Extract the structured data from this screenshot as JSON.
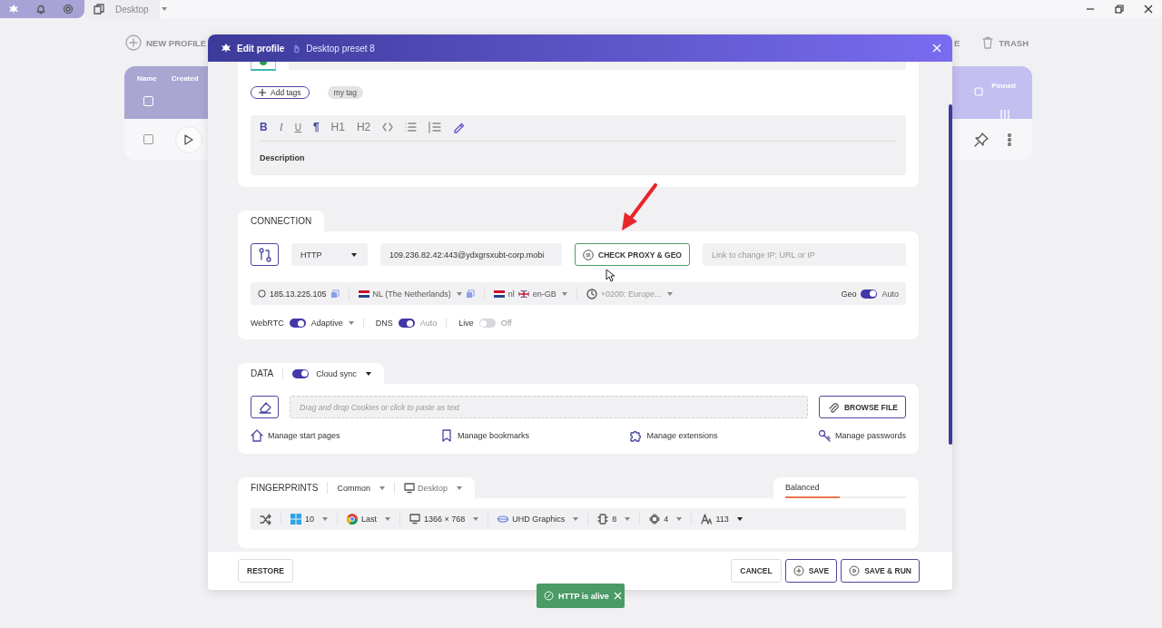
{
  "app_bar": {
    "tab_label": "Desktop"
  },
  "toolbar": {
    "new_profile": "NEW PROFILE",
    "cut_label": "E",
    "trash": "TRASH"
  },
  "profiles_table": {
    "columns": [
      "Name",
      "Created"
    ],
    "pinned_column": "Pinned",
    "select_all": {
      "checked": false
    },
    "rows": [
      {
        "checked": false
      }
    ]
  },
  "dialog": {
    "title": "Edit profile",
    "preset": "Desktop preset 8",
    "tags": {
      "add_label": "Add tags",
      "items": [
        "my tag"
      ]
    },
    "editor": {
      "tools": [
        "B",
        "I",
        "U",
        "¶",
        "H1",
        "H2"
      ],
      "label": "Description"
    },
    "connection": {
      "title": "CONNECTION",
      "proxy_type": "HTTP",
      "proxy": "109.236.82.42:443@ydxgrsxubt-corp.mobi",
      "check_button": "CHECK PROXY & GEO",
      "change_ip_placeholder": "Link to change IP: URL or IP",
      "ip": "185.13.225.105",
      "country": "NL (The Netherlands)",
      "language": "nl",
      "locale": "en-GB",
      "timezone": "+0200: Europe...",
      "geo": {
        "label": "Geo",
        "on": true,
        "value": "Auto"
      },
      "switches": [
        {
          "kind": "select",
          "label": "WebRTC",
          "on": true,
          "value": "Adaptive"
        },
        {
          "kind": "plain",
          "label": "DNS",
          "on": true,
          "value": "Auto"
        },
        {
          "kind": "plain",
          "label": "Live",
          "on": false,
          "value": "Off"
        }
      ]
    },
    "data": {
      "title": "DATA",
      "cloud_sync": {
        "label": "Cloud sync",
        "on": true
      },
      "cookies_placeholder": "Drag and drop Cookies or click to paste as text",
      "browse_button": "BROWSE FILE",
      "links": [
        {
          "kind": "home",
          "label": "Manage start pages"
        },
        {
          "kind": "bookmark",
          "label": "Manage bookmarks"
        },
        {
          "kind": "puzzle",
          "label": "Manage extensions"
        },
        {
          "kind": "key",
          "label": "Manage passwords"
        }
      ]
    },
    "fingerprints": {
      "title": "FINGERPRINTS",
      "mode": "Common",
      "device": "Desktop",
      "preset": {
        "label": "Balanced",
        "level": 0.45
      },
      "params": [
        {
          "kind": "os",
          "value": "10"
        },
        {
          "kind": "browser",
          "value": "Last"
        },
        {
          "kind": "screen",
          "value": "1366 × 768"
        },
        {
          "kind": "gpu",
          "value": "UHD Graphics"
        },
        {
          "kind": "memory",
          "value": "8"
        },
        {
          "kind": "cpu",
          "value": "4"
        },
        {
          "kind": "fonts",
          "value": "113"
        }
      ]
    },
    "footer": {
      "restore": "RESTORE",
      "cancel": "CANCEL",
      "save": "SAVE",
      "save_run": "SAVE & RUN"
    }
  },
  "toast": {
    "text": "HTTP is alive"
  }
}
